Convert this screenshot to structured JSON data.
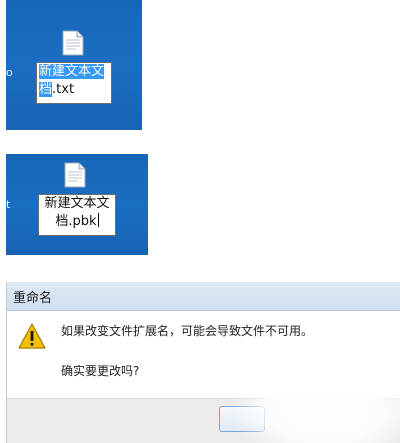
{
  "scene1": {
    "side_text": "o",
    "rename_selected": "新建文本文档",
    "rename_rest": ".txt"
  },
  "scene2": {
    "side_text": "t",
    "rename_line1": "新建文本文",
    "rename_line2": "档.pbk"
  },
  "dialog": {
    "title": "重命名",
    "message": "如果改变文件扩展名，可能会导致文件不可用。",
    "question": "确实要更改吗?"
  },
  "icons": {
    "file": "text-file-icon",
    "warning": "warning-icon"
  },
  "colors": {
    "desktop_blue": "#1a6ec2",
    "selection": "#3399ff",
    "warning_yellow": "#f2c200"
  }
}
